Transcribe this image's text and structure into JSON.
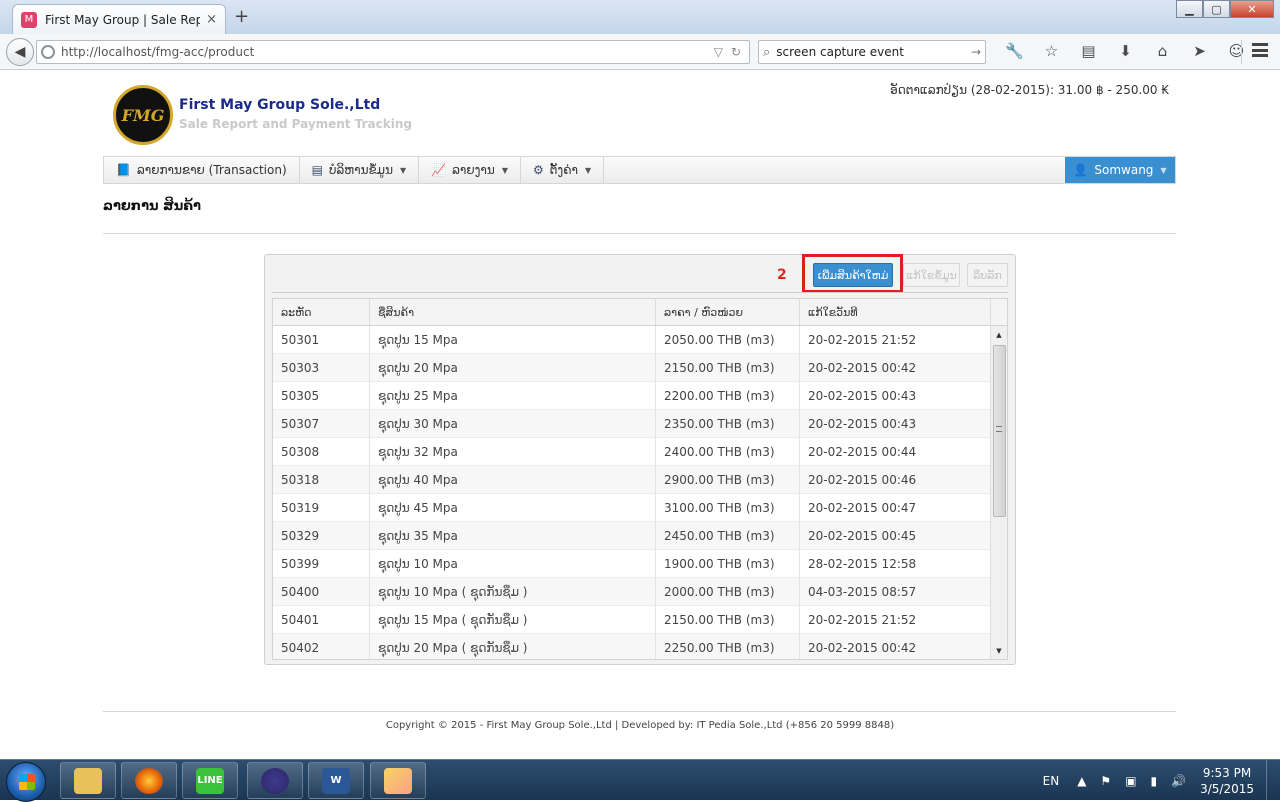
{
  "browser": {
    "tab_title": "First May Group | Sale Rep...",
    "tab_close": "×",
    "new_tab": "+",
    "url": "http://localhost/fmg-acc/product",
    "search_query": "screen capture event",
    "window_buttons": {
      "minimize": "▁",
      "maximize": "▢",
      "close": "✕"
    }
  },
  "header": {
    "logo_text": "FMG",
    "company": "First May Group Sole.,Ltd",
    "tagline": "Sale Report and Payment Tracking",
    "rate": "ອັດຕາແລກປ່ຽນ (28-02-2015): 31.00 ฿ - 250.00 ₭"
  },
  "nav": {
    "items": [
      {
        "label": "ລາຍການຂາຍ (Transaction)",
        "icon": "book-icon",
        "glyph": "📘"
      },
      {
        "label": "ບໍລິຫານຂໍ້ມູນ",
        "icon": "list-icon",
        "glyph": "▤",
        "dropdown": true
      },
      {
        "label": "ລາຍງານ",
        "icon": "chart-icon",
        "glyph": "📈",
        "dropdown": true
      },
      {
        "label": "ຕັ້ງຄ່າ",
        "icon": "gear-icon",
        "glyph": "⚙",
        "dropdown": true
      }
    ],
    "user": "Somwang",
    "user_glyph": "👤",
    "caret": "▼"
  },
  "page_title": "ລາຍການ ສິນຄ້າ",
  "toolbar": {
    "annotation": "2",
    "add_label": "ເພີ່ມສິນຄ້າໃຫມ່",
    "edit_label": "ແກ້ໃຂຂໍ້ມູນ",
    "delete_label": "ລຶບລັກ"
  },
  "table": {
    "columns": [
      "ລະຫັດ",
      "ຊື່ສິນຄ້າ",
      "ລາຄາ / ຫົວໜ່ວຍ",
      "ແກ້ໃຂວັນທີ"
    ],
    "rows": [
      [
        "50301",
        "ຊຸດປູນ 15 Mpa",
        "2050.00 THB (m3)",
        "20-02-2015 21:52"
      ],
      [
        "50303",
        "ຊຸດປູນ 20 Mpa",
        "2150.00 THB (m3)",
        "20-02-2015 00:42"
      ],
      [
        "50305",
        "ຊຸດປູນ 25 Mpa",
        "2200.00 THB (m3)",
        "20-02-2015 00:43"
      ],
      [
        "50307",
        "ຊຸດປູນ 30 Mpa",
        "2350.00 THB (m3)",
        "20-02-2015 00:43"
      ],
      [
        "50308",
        "ຊຸດປູນ 32 Mpa",
        "2400.00 THB (m3)",
        "20-02-2015 00:44"
      ],
      [
        "50318",
        "ຊຸດປູນ 40 Mpa",
        "2900.00 THB (m3)",
        "20-02-2015 00:46"
      ],
      [
        "50319",
        "ຊຸດປູນ 45 Mpa",
        "3100.00 THB (m3)",
        "20-02-2015 00:47"
      ],
      [
        "50329",
        "ຊຸດປູນ 35 Mpa",
        "2450.00 THB (m3)",
        "20-02-2015 00:45"
      ],
      [
        "50399",
        "ຊຸດປູນ 10 Mpa",
        "1900.00 THB (m3)",
        "28-02-2015 12:58"
      ],
      [
        "50400",
        "ຊຸດປູນ 10 Mpa ( ຊຸດກັນຊຶມ )",
        "2000.00 THB (m3)",
        "04-03-2015 08:57"
      ],
      [
        "50401",
        "ຊຸດປູນ 15 Mpa ( ຊຸດກັນຊຶມ )",
        "2150.00 THB (m3)",
        "20-02-2015 21:52"
      ],
      [
        "50402",
        "ຊຸດປູນ 20 Mpa ( ຊຸດກັນຊຶມ )",
        "2250.00 THB (m3)",
        "20-02-2015 00:42"
      ]
    ]
  },
  "footer": "Copyright © 2015 - First May Group Sole.,Ltd | Developed by: IT Pedia Sole.,Ltd (+856 20 5999 8848)",
  "taskbar": {
    "apps": [
      "file-explorer",
      "firefox",
      "line",
      "eclipse",
      "word",
      "paint"
    ],
    "lang": "EN",
    "time": "9:53 PM",
    "date": "3/5/2015"
  },
  "colors": {
    "accent": "#3a8fd1",
    "brand": "#1a2b8a",
    "annotation": "#e01e1e"
  }
}
